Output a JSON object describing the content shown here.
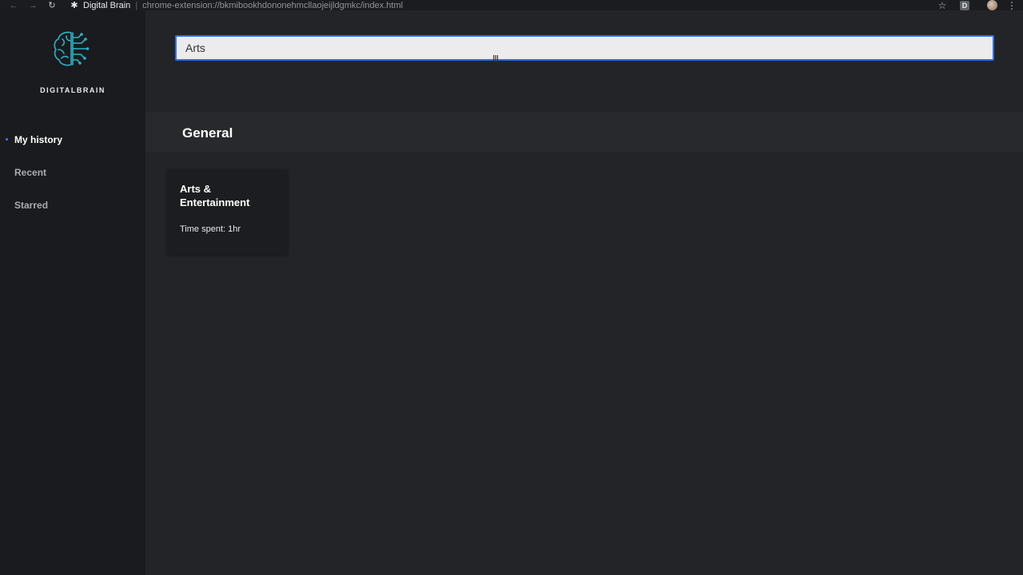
{
  "browser": {
    "site_name": "Digital Brain",
    "separator": "|",
    "url": "chrome-extension://bkmibookhdononehmcllaojeijldgmkc/index.html",
    "profile_badge": "D"
  },
  "sidebar": {
    "brand": "DIGITALBRAIN",
    "items": [
      {
        "label": "My history",
        "active": true
      },
      {
        "label": "Recent",
        "active": false
      },
      {
        "label": "Starred",
        "active": false
      }
    ]
  },
  "search": {
    "value": "Arts"
  },
  "section": {
    "title": "General"
  },
  "cards": [
    {
      "title": "Arts & Entertainment",
      "meta": "Time spent: 1hr"
    }
  ],
  "colors": {
    "accent": "#2f6fe5",
    "logo": "#2bb3c9",
    "active_dot": "#5b6cff"
  }
}
